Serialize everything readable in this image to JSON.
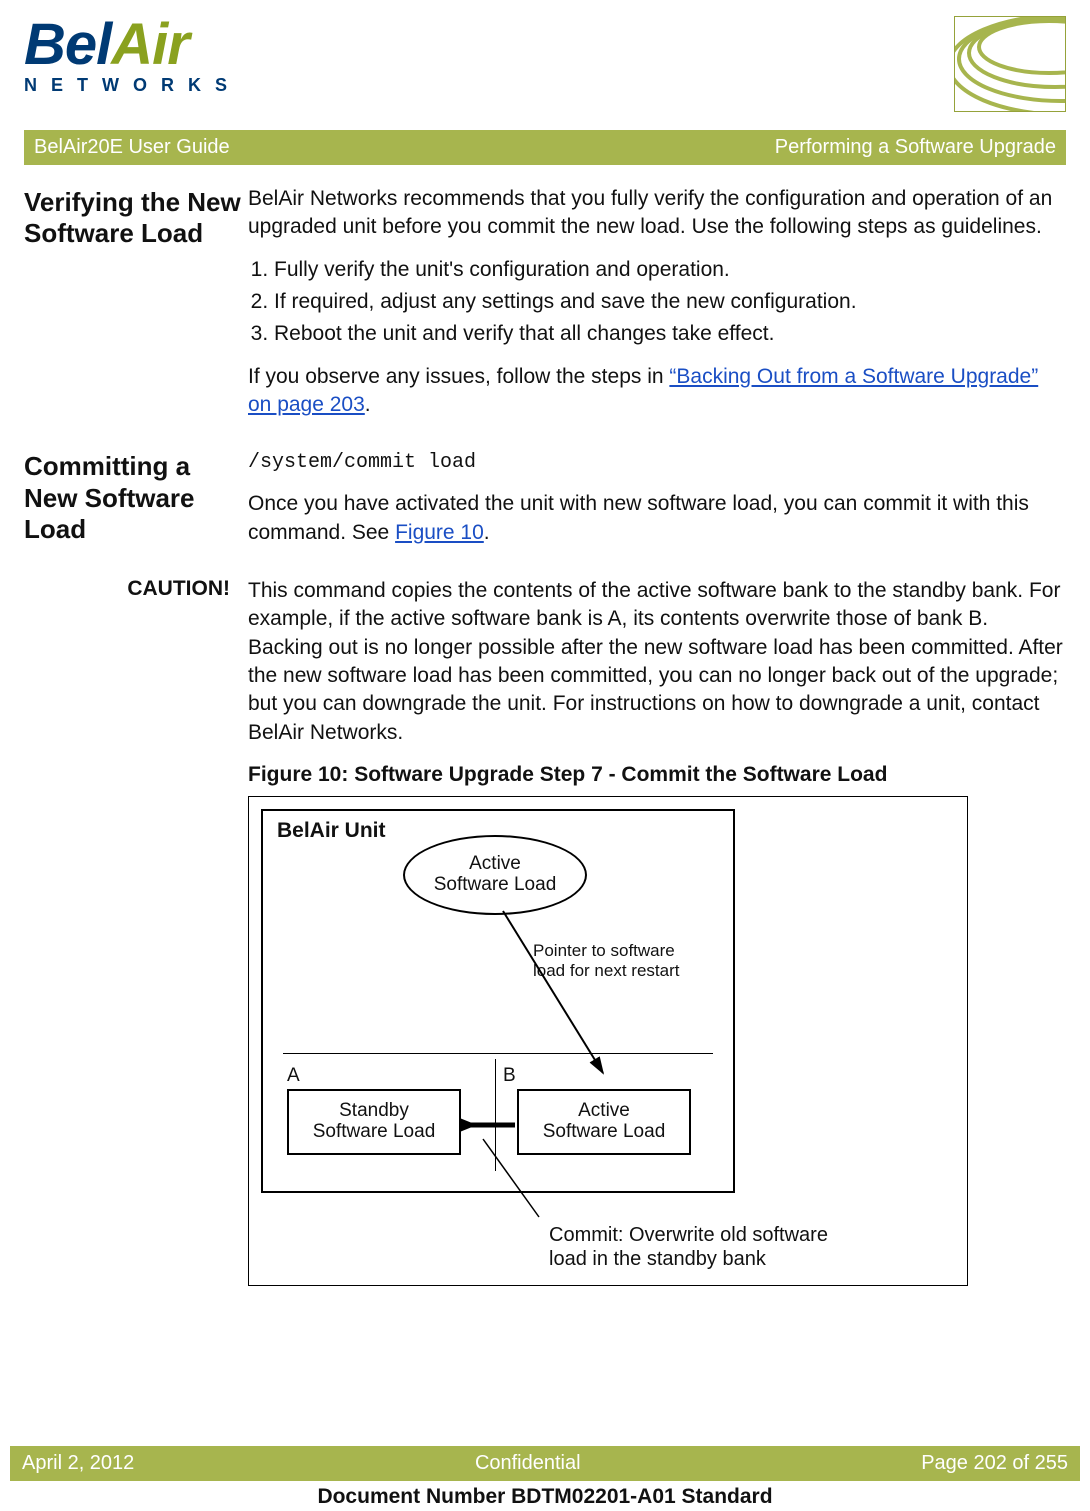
{
  "logo": {
    "prefix": "Bel",
    "suffix": "Air",
    "sub": "NETWORKS"
  },
  "titlebar": {
    "left": "BelAir20E User Guide",
    "right": "Performing a Software Upgrade"
  },
  "sec1": {
    "heading": "Verifying the New Software Load",
    "intro": "BelAir Networks recommends that you fully verify the configuration and operation of an upgraded unit before you commit the new load. Use the following steps as guidelines.",
    "steps": [
      "Fully verify the unit's configuration and operation.",
      "If required, adjust any settings and save the new configuration.",
      "Reboot the unit and verify that all changes take effect."
    ],
    "followup_pre": "If you observe any issues, follow the steps in ",
    "followup_link": "“Backing Out from a Software Upgrade” on page 203",
    "followup_post": "."
  },
  "sec2": {
    "heading": "Committing a New Software Load",
    "command": "/system/commit load",
    "text_pre": "Once you have activated the unit with new software load, you can commit it with this command. See ",
    "text_link": "Figure 10",
    "text_post": "."
  },
  "caution": {
    "label": "CAUTION!",
    "body": "This command copies the contents of the active software bank to the standby bank. For example, if the active software bank is A, its contents overwrite those of bank B. Backing out is no longer possible after the new software load has been committed. After the new software load has been committed, you can no longer back out of the upgrade; but you can downgrade the unit. For instructions on how to downgrade a unit, contact BelAir Networks."
  },
  "figure": {
    "caption": "Figure 10: Software Upgrade Step 7 - Commit the Software Load",
    "unit_title": "BelAir Unit",
    "ellipse_l1": "Active",
    "ellipse_l2": "Software Load",
    "pointer_l1": "Pointer to software",
    "pointer_l2": "load for next restart",
    "bank_a_label": "A",
    "bank_b_label": "B",
    "bank_a_l1": "Standby",
    "bank_a_l2": "Software Load",
    "bank_b_l1": "Active",
    "bank_b_l2": "Software Load",
    "commit_l1": "Commit: Overwrite old software",
    "commit_l2": "load in the standby bank"
  },
  "footer": {
    "date": "April 2, 2012",
    "conf": "Confidential",
    "page": "Page 202 of 255",
    "docnum": "Document Number BDTM02201-A01 Standard"
  }
}
